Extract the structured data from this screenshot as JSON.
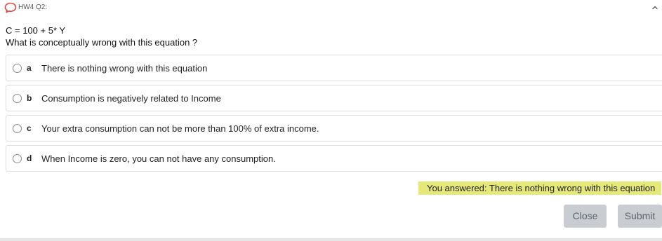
{
  "header": {
    "title": "HW4 Q2:",
    "icon": "speech-bubble-icon",
    "collapse_icon": "chevron-up-icon",
    "accent_color": "#e8403a"
  },
  "question": {
    "equation": "C = 100 + 5* Y",
    "prompt": "What is conceptually wrong with this equation ?"
  },
  "options": [
    {
      "letter": "a",
      "text": "There is nothing wrong with this equation"
    },
    {
      "letter": "b",
      "text": "Consumption is negatively related to Income"
    },
    {
      "letter": "c",
      "text": "Your extra consumption can not be more than 100% of extra income."
    },
    {
      "letter": "d",
      "text": "When Income is zero, you can not have any consumption."
    }
  ],
  "feedback": {
    "answered_text": "You answered: There is nothing wrong with this equation",
    "highlight_color": "#e5e97a"
  },
  "actions": {
    "close_label": "Close",
    "submit_label": "Submit"
  }
}
